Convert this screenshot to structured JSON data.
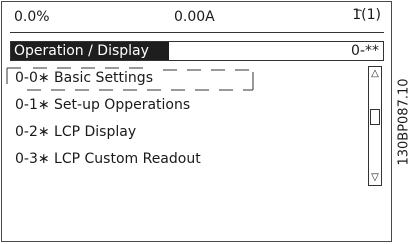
{
  "status": {
    "left": "0.0%",
    "center": "0.00A",
    "right": "1(1)"
  },
  "title": {
    "label": "Operation / Display",
    "code": "0-**"
  },
  "menu": {
    "items": [
      {
        "label": "0-0∗ Basic Settings"
      },
      {
        "label": "0-1∗ Set-up Opperations"
      },
      {
        "label": "0-2∗ LCP Display"
      },
      {
        "label": "0-3∗ LCP Custom Readout"
      }
    ]
  },
  "figure_code": "130BP087.10",
  "icons": {
    "scroll_up": "triangle-up-icon",
    "scroll_down": "triangle-down-icon",
    "menu_arrow": "arch-icon"
  }
}
